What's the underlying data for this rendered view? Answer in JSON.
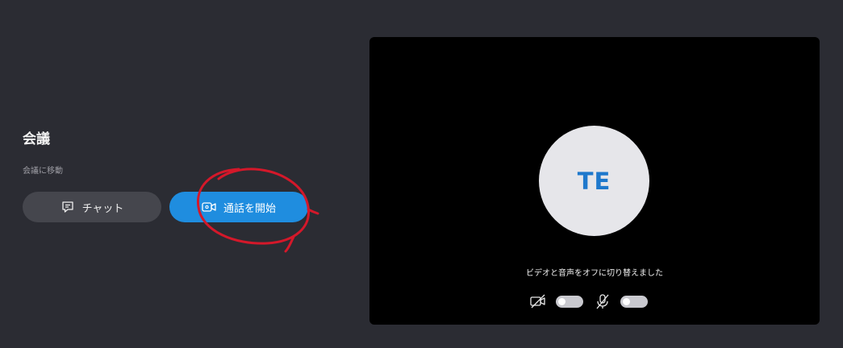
{
  "meeting": {
    "title": "会議",
    "move_label": "会議に移動"
  },
  "buttons": {
    "chat_label": "チャット",
    "start_call_label": "通話を開始"
  },
  "preview": {
    "avatar_initials": "TE",
    "status_text": "ビデオと音声をオフに切り替えました",
    "video_toggle": "off",
    "audio_toggle": "off"
  },
  "colors": {
    "background": "#2b2c33",
    "accent": "#1f8ddf",
    "avatar_text": "#1e78cc",
    "annotation": "#d4182a"
  },
  "icons": {
    "chat": "chat-icon",
    "call": "video-call-icon",
    "video_off": "video-off-icon",
    "mic_off": "mic-off-icon"
  }
}
